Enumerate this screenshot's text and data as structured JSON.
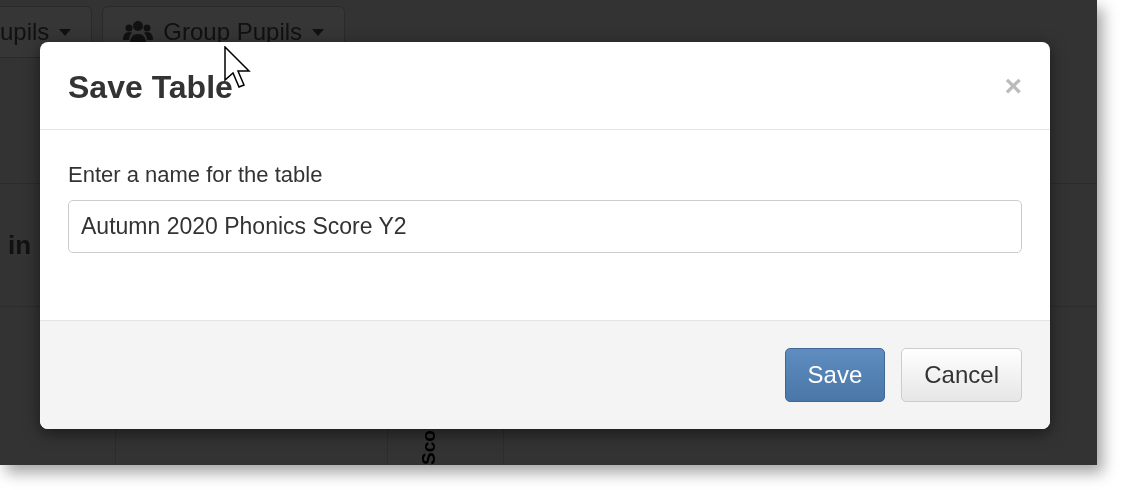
{
  "background": {
    "toolbar": [
      {
        "label": "upils",
        "kind": "plain"
      },
      {
        "label": "Group Pupils",
        "kind": "group"
      }
    ],
    "row_text": "in",
    "column_heading": "Sco"
  },
  "dialog": {
    "title": "Save Table",
    "close": "×",
    "field_label": "Enter a name for the table",
    "field_value": "Autumn 2020 Phonics Score Y2",
    "buttons": [
      {
        "label": "Save",
        "kind": "primary"
      },
      {
        "label": "Cancel",
        "kind": "default"
      }
    ]
  }
}
